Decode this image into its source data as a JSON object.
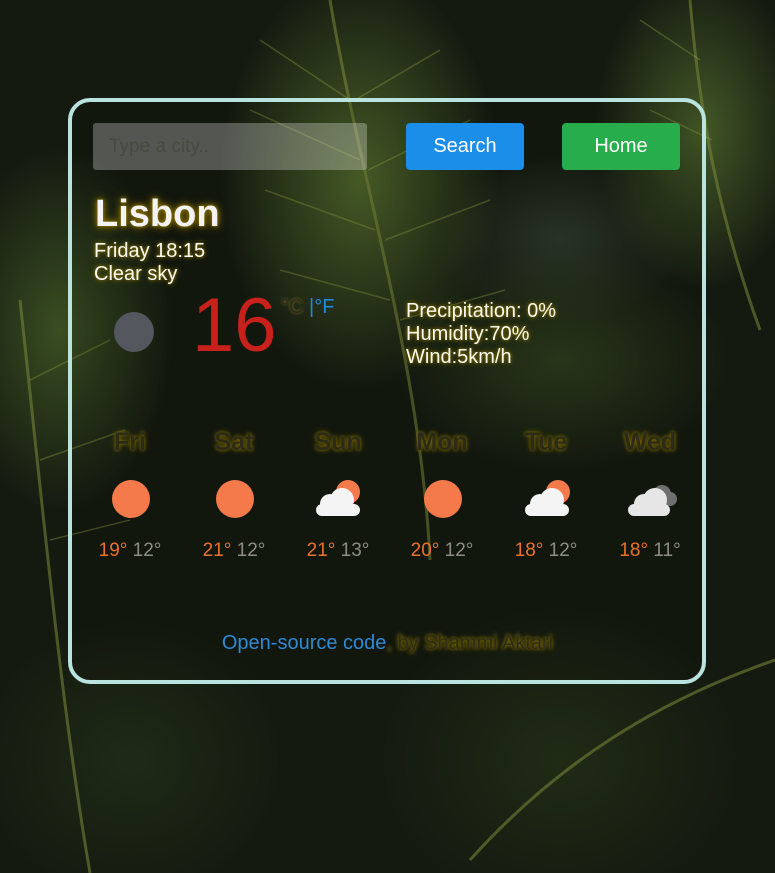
{
  "search": {
    "placeholder": "Type a city.."
  },
  "buttons": {
    "search_label": "Search",
    "home_label": "Home"
  },
  "current": {
    "city": "Lisbon",
    "datetime": "Friday 18:15",
    "description": "Clear sky",
    "icon": "moon-icon",
    "temperature": "16",
    "unit_c": "°C",
    "unit_sep": " |",
    "unit_f": "°F",
    "precipitation": "Precipitation: 0%",
    "humidity": "Humidity:70%",
    "wind": "Wind:5km/h"
  },
  "forecast": [
    {
      "day": "Fri",
      "icon": "sun-icon",
      "max": "19°",
      "min": "12°"
    },
    {
      "day": "Sat",
      "icon": "sun-icon",
      "max": "21°",
      "min": "12°"
    },
    {
      "day": "Sun",
      "icon": "partly-cloudy-icon",
      "max": "21°",
      "min": "13°"
    },
    {
      "day": "Mon",
      "icon": "sun-icon",
      "max": "20°",
      "min": "12°"
    },
    {
      "day": "Tue",
      "icon": "partly-cloudy-icon",
      "max": "18°",
      "min": "12°"
    },
    {
      "day": "Wed",
      "icon": "cloudy-icon",
      "max": "18°",
      "min": "11°"
    }
  ],
  "footer": {
    "link_text": "Open-source code",
    "by_text": ", by Shammi Aktari"
  },
  "colors": {
    "search_button": "#1a8ee8",
    "home_button": "#27ad4b",
    "temperature": "#c8201a",
    "max_temp": "#e8722a",
    "card_border": "#b9e3df"
  }
}
